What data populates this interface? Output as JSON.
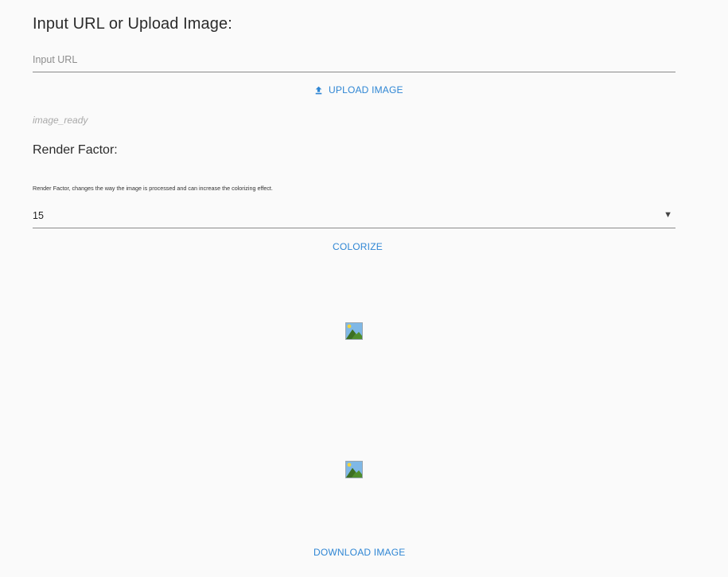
{
  "form": {
    "title": "Input URL or Upload Image:",
    "url_placeholder": "Input URL",
    "url_value": "",
    "upload_label": "UPLOAD IMAGE",
    "status": "image_ready"
  },
  "render": {
    "title": "Render Factor:",
    "helper": "Render Factor,  changes the way the image is processed and can increase the colorizing effect.",
    "selected_value": "15",
    "arrow": "▼"
  },
  "actions": {
    "colorize_label": "COLORIZE",
    "download_label": "DOWNLOAD IMAGE"
  },
  "icons": {
    "upload": "upload-icon",
    "image": "broken-image-icon"
  },
  "colors": {
    "accent": "#2f86d4",
    "background": "#fafafa"
  }
}
